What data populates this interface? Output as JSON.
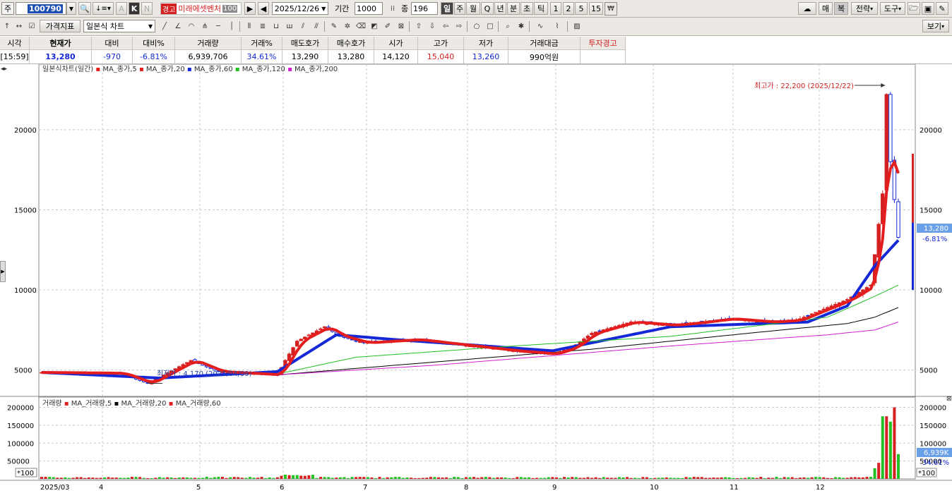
{
  "toolbar1": {
    "market_label": "주",
    "code": "100790",
    "warning_badge": "경고",
    "stock_name": "미래에셋벤처",
    "ratio_badge": "100",
    "date": "2025/12/26",
    "period_label": "기간",
    "period_value": "1000",
    "count_label": "종",
    "count_value": "196",
    "timeframes": [
      "일",
      "주",
      "월",
      "Q",
      "년",
      "분",
      "초",
      "틱",
      "1",
      "2",
      "5",
      "15"
    ],
    "right_buttons": [
      "매",
      "복",
      "전략",
      "도구"
    ]
  },
  "toolbar2": {
    "indicator_button": "가격지표",
    "chart_type_select": "일본식 차트",
    "view_button": "보기"
  },
  "quote": {
    "headers": [
      "시각",
      "현재가",
      "대비",
      "대비%",
      "거래량",
      "거래%",
      "매도호가",
      "매수호가",
      "시가",
      "고가",
      "저가",
      "거래대금",
      "투자경고"
    ],
    "values": [
      "[15:59]",
      "13,280",
      "-970",
      "-6.81%",
      "6,939,706",
      "34.61%",
      "13,290",
      "13,280",
      "14,120",
      "15,040",
      "13,260",
      "990억원",
      ""
    ]
  },
  "legend": {
    "title": "일본식차트(일간)",
    "items": [
      "MA_종가,5",
      "MA_종가,20",
      "MA_종가,60",
      "MA_종가,120",
      "MA_종가,200"
    ],
    "colors": [
      "#e41e1e",
      "#e41e1e",
      "#1428d8",
      "#22c022",
      "#d020d0"
    ]
  },
  "volume_legend": {
    "title": "거래량",
    "items": [
      "MA_거래량,5",
      "MA_거래량,20",
      "MA_거래량,60"
    ],
    "colors": [
      "#e41e1e",
      "#000000",
      "#e41e1e",
      "#22c022"
    ]
  },
  "annotations": {
    "high": "최고가 : 22,200 (2025/12/22)",
    "low": "최저가 : 4,170 (2025/04/09)"
  },
  "price_badge": {
    "price": "13,280",
    "pct": "-6.81%"
  },
  "volume_badge": {
    "value": "6,939K",
    "pct": "34.61%"
  },
  "price_scale_note": "*100",
  "chart_data": {
    "type": "candlestick",
    "x_ticks": [
      "2025/03",
      "4",
      "5",
      "6",
      "7",
      "8",
      "9",
      "10",
      "11",
      "12"
    ],
    "price_ticks": [
      5000,
      10000,
      15000,
      20000
    ],
    "price_ylim": [
      3400,
      24000
    ],
    "volume_ticks": [
      50000,
      100000,
      150000,
      200000
    ],
    "volume_ylim": [
      0,
      205000
    ],
    "volume_unit": "*100",
    "series": [
      {
        "name": "close",
        "approx_path": [
          [
            0,
            4850
          ],
          [
            20,
            4800
          ],
          [
            27,
            4170
          ],
          [
            38,
            5600
          ],
          [
            45,
            4900
          ],
          [
            60,
            4700
          ],
          [
            62,
            5600
          ],
          [
            65,
            6800
          ],
          [
            72,
            7700
          ],
          [
            76,
            7100
          ],
          [
            82,
            6700
          ],
          [
            95,
            6900
          ],
          [
            120,
            6200
          ],
          [
            130,
            6000
          ],
          [
            135,
            6400
          ],
          [
            140,
            7300
          ],
          [
            150,
            8000
          ],
          [
            160,
            7800
          ],
          [
            165,
            7900
          ],
          [
            175,
            8200
          ],
          [
            185,
            8000
          ],
          [
            192,
            8100
          ],
          [
            198,
            8700
          ],
          [
            205,
            9400
          ],
          [
            211,
            10300
          ],
          [
            214,
            16000
          ],
          [
            215,
            22200
          ],
          [
            216,
            18000
          ],
          [
            218,
            13280
          ]
        ]
      },
      {
        "name": "MA_종가,60",
        "approx_path": [
          [
            0,
            4850
          ],
          [
            30,
            4500
          ],
          [
            60,
            4900
          ],
          [
            75,
            7200
          ],
          [
            90,
            6900
          ],
          [
            130,
            6200
          ],
          [
            160,
            7700
          ],
          [
            195,
            8000
          ],
          [
            205,
            9000
          ],
          [
            212,
            11500
          ],
          [
            218,
            13100
          ]
        ]
      },
      {
        "name": "MA_종가,120",
        "approx_path": [
          [
            60,
            4750
          ],
          [
            80,
            5800
          ],
          [
            120,
            6500
          ],
          [
            160,
            7100
          ],
          [
            200,
            8300
          ],
          [
            212,
            9600
          ],
          [
            218,
            10300
          ]
        ]
      },
      {
        "name": "MA_종가,200",
        "approx_path": [
          [
            60,
            4700
          ],
          [
            100,
            5500
          ],
          [
            140,
            6300
          ],
          [
            180,
            7300
          ],
          [
            205,
            7900
          ],
          [
            212,
            8300
          ],
          [
            218,
            8900
          ]
        ]
      },
      {
        "name": "MA_종가,5",
        "approx_path": [
          [
            60,
            4700
          ],
          [
            100,
            5300
          ],
          [
            160,
            6500
          ],
          [
            200,
            7200
          ],
          [
            212,
            7500
          ],
          [
            218,
            8000
          ]
        ]
      }
    ],
    "volume_spikes": [
      [
        212,
        30000
      ],
      [
        213,
        45000
      ],
      [
        214,
        175000
      ],
      [
        215,
        175000
      ],
      [
        216,
        160000
      ],
      [
        217,
        200000
      ],
      [
        218,
        69397
      ]
    ]
  }
}
